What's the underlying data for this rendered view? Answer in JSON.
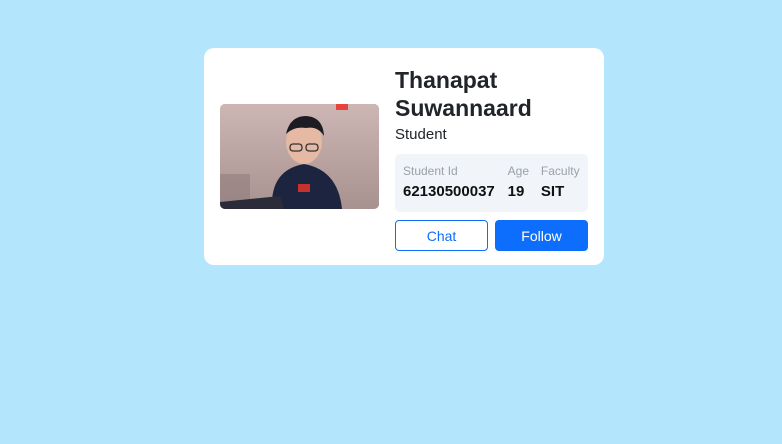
{
  "profile": {
    "name": "Thanapat Suwannaard",
    "role": "Student",
    "photo_alt": "profile photo"
  },
  "stats": [
    {
      "label": "Student Id",
      "value": "62130500037"
    },
    {
      "label": "Age",
      "value": "19"
    },
    {
      "label": "Faculty",
      "value": "SIT"
    }
  ],
  "actions": {
    "chat_label": "Chat",
    "follow_label": "Follow"
  },
  "colors": {
    "page_background": "#b3e5fc",
    "card_background": "#ffffff",
    "primary": "#0d6efd",
    "stats_background": "#f1f4f8"
  }
}
